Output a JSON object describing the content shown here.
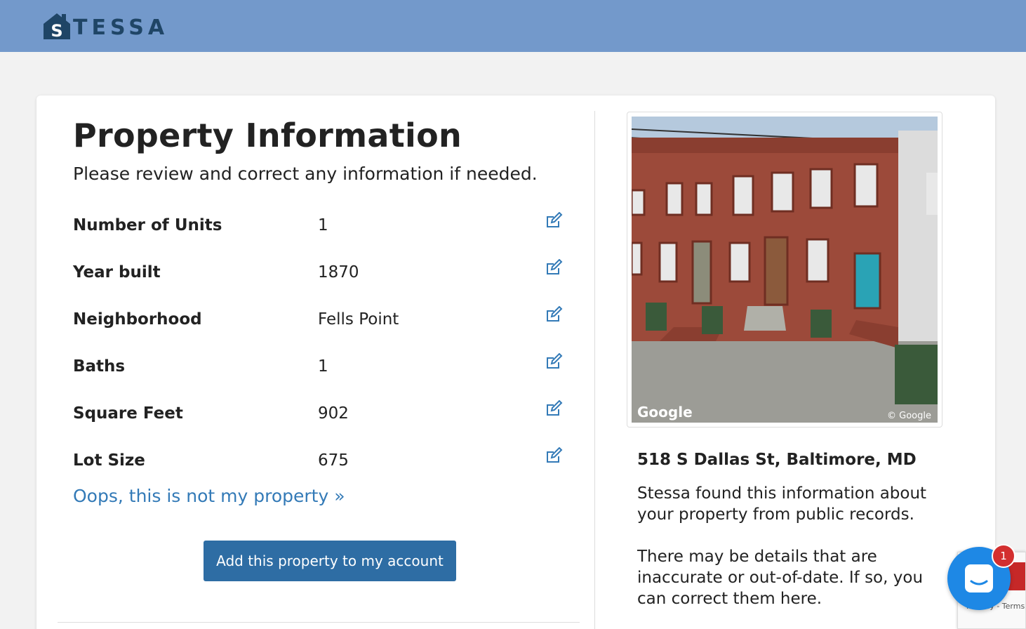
{
  "header": {
    "logo_text": "STESSA",
    "logo_tail": "TESSA",
    "logo_initial": "S"
  },
  "main": {
    "title": "Property Information",
    "subtitle": "Please review and correct any information if needed.",
    "fields": [
      {
        "label": "Number of Units",
        "value": "1",
        "icon": "edit-icon"
      },
      {
        "label": "Year built",
        "value": "1870",
        "icon": "edit-icon"
      },
      {
        "label": "Neighborhood",
        "value": "Fells Point",
        "icon": "edit-icon"
      },
      {
        "label": "Baths",
        "value": "1",
        "icon": "edit-icon"
      },
      {
        "label": "Square Feet",
        "value": "902",
        "icon": "edit-icon"
      },
      {
        "label": "Lot Size",
        "value": "675",
        "icon": "edit-icon"
      }
    ],
    "not_my_property_link": "Oops, this is not my property",
    "add_button": "Add this property to my account"
  },
  "sidebar": {
    "photo_watermark_left": "Google",
    "photo_watermark_right": "© Google",
    "address": "518 S Dallas St, Baltimore, MD",
    "info_paragraph_1": "Stessa found this information about your property from public records.",
    "info_paragraph_2": "There may be details that are inaccurate or out-of-date. If so, you can correct them here."
  },
  "widgets": {
    "chat_badge_count": "1",
    "recaptcha_text": "Privacy - Terms"
  },
  "colors": {
    "header_bg": "#7399cb",
    "brand_dark": "#1f4566",
    "link": "#337ab7",
    "button": "#2e6da4"
  }
}
